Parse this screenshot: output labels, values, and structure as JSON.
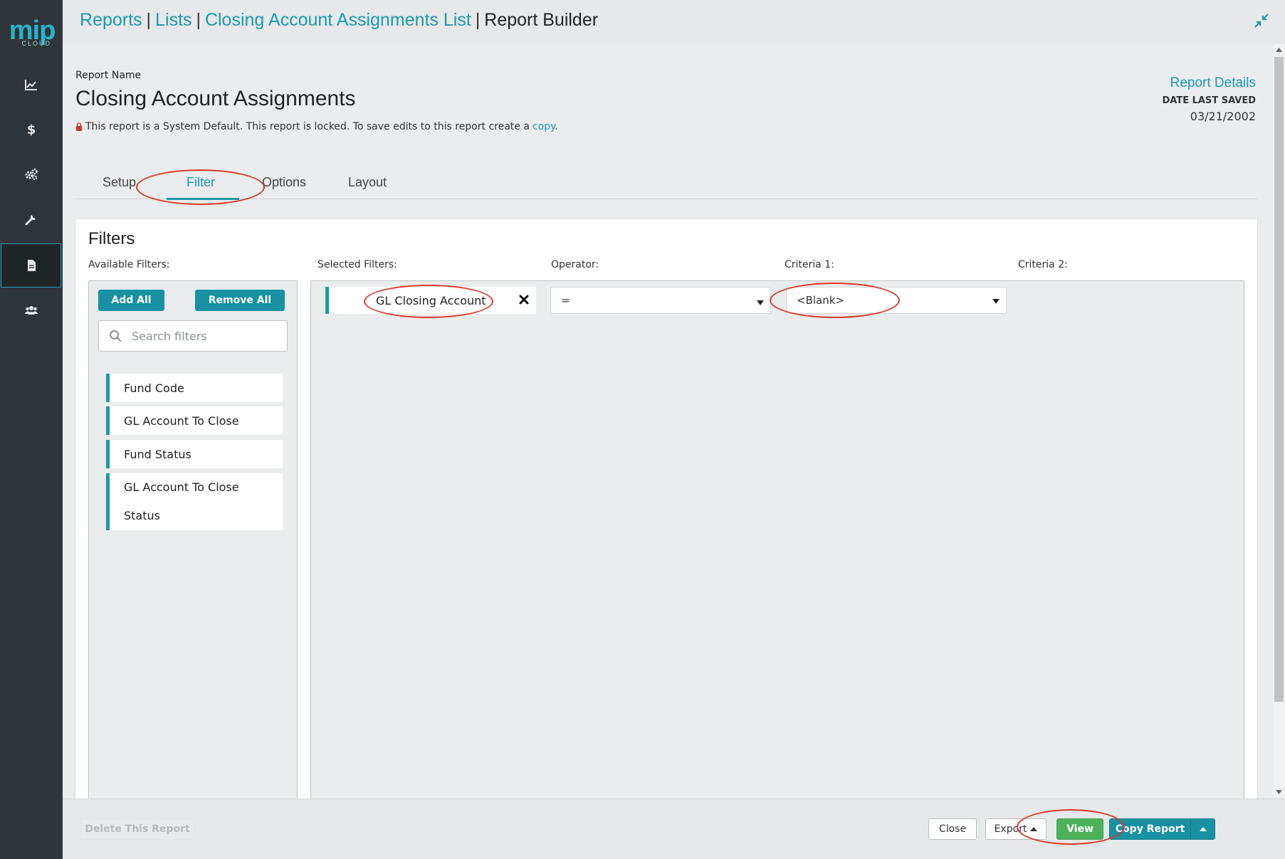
{
  "app": {
    "logo_main": "mip",
    "logo_sub": "CLOUD"
  },
  "sidebar": {
    "items": [
      {
        "name": "reports-chart",
        "icon": "line-chart-icon"
      },
      {
        "name": "dollar",
        "icon": "dollar-icon"
      },
      {
        "name": "settings",
        "icon": "gears-icon"
      },
      {
        "name": "tools",
        "icon": "wrench-icon"
      },
      {
        "name": "documents",
        "icon": "document-icon",
        "active": true
      },
      {
        "name": "users",
        "icon": "users-icon"
      }
    ]
  },
  "breadcrumb": {
    "items": [
      "Reports",
      "Lists",
      "Closing Account Assignments List"
    ],
    "separator": "|",
    "current": "Report Builder"
  },
  "report": {
    "name_label": "Report Name",
    "title": "Closing Account Assignments",
    "locked_message": "This report is a System Default. This report is locked. To save edits to this report create a",
    "copy_link": "copy",
    "period": "."
  },
  "details": {
    "title": "Report Details",
    "date_label": "DATE LAST SAVED",
    "date_value": "03/21/2002"
  },
  "tabs": [
    {
      "label": "Setup",
      "active": false
    },
    {
      "label": "Filter",
      "active": true
    },
    {
      "label": "Options",
      "active": false
    },
    {
      "label": "Layout",
      "active": false
    }
  ],
  "filters": {
    "title": "Filters",
    "available_label": "Available Filters:",
    "selected_label": "Selected Filters:",
    "operator_label": "Operator:",
    "criteria1_label": "Criteria 1:",
    "criteria2_label": "Criteria 2:",
    "add_all": "Add All",
    "remove_all": "Remove All",
    "search_placeholder": "Search filters",
    "available": [
      "Fund Code",
      "GL Account To Close",
      "Fund Status",
      "GL Account To Close Status"
    ],
    "available_last_lines": [
      "GL Account To Close",
      "Status"
    ],
    "selected": [
      {
        "name": "GL Closing Account",
        "operator": "=",
        "criteria1": "<Blank>"
      }
    ]
  },
  "footer": {
    "delete": "Delete This Report",
    "close": "Close",
    "export": "Export",
    "view": "View",
    "copy_report": "Copy Report"
  },
  "colors": {
    "accent": "#1a9aab",
    "sidebar": "#2f3438",
    "view_green": "#4db15a",
    "annotation_red": "#d9392b"
  }
}
